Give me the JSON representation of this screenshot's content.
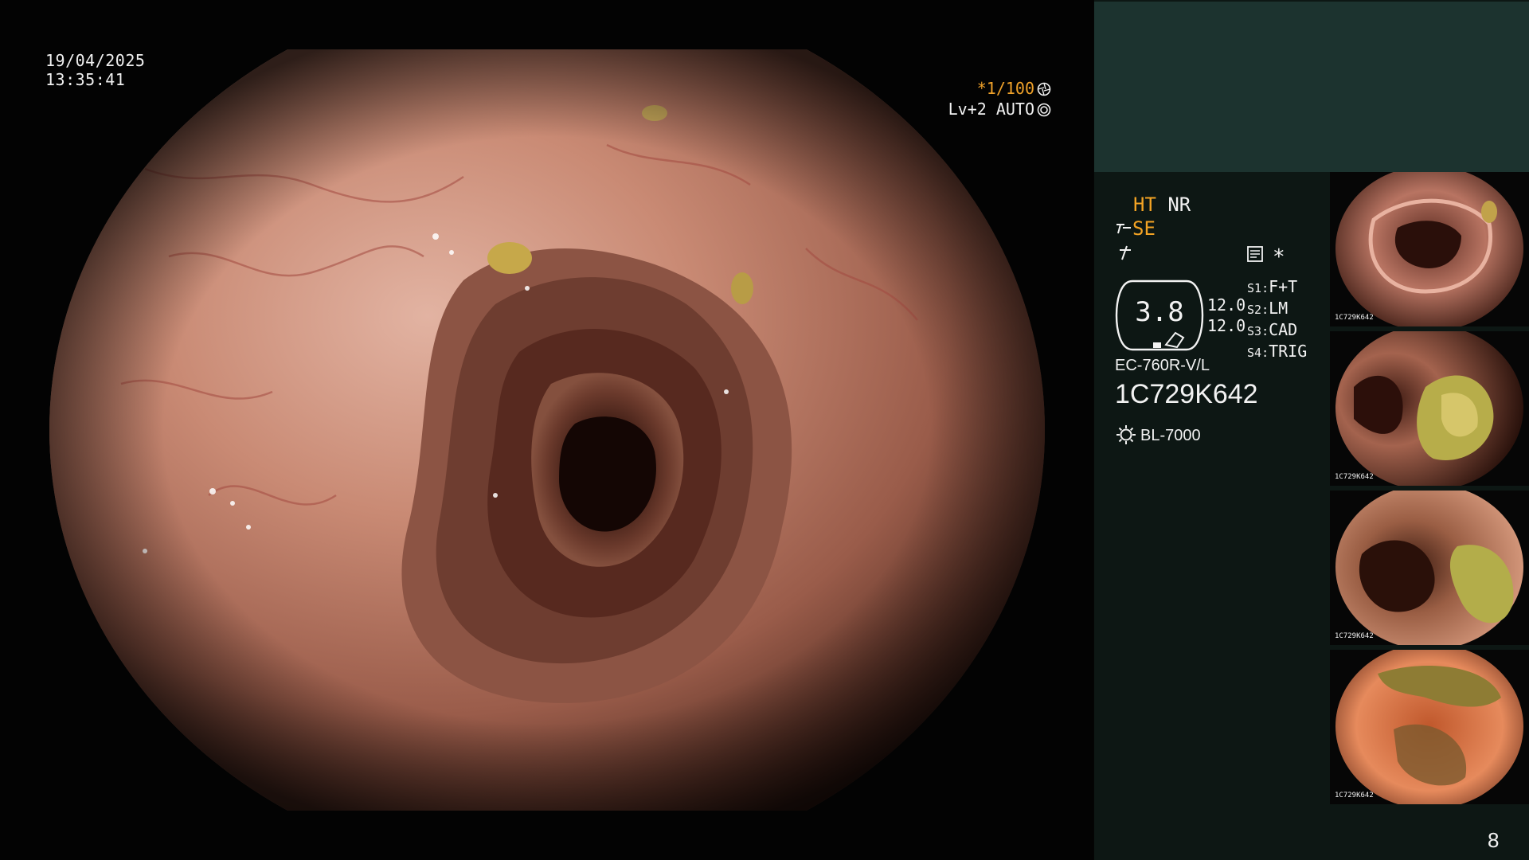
{
  "datetime": {
    "date": "19/04/2025",
    "time": "13:35:41"
  },
  "overlay": {
    "shutter": "*1/100",
    "shutter_icon": "aperture-icon",
    "level": "Lv+2 AUTO",
    "level_icon": "iris-icon"
  },
  "info": {
    "ht": "HT",
    "nr": "NR",
    "se": "SE",
    "zoom_value": "3.8",
    "val1": "12.0",
    "val2": "12.0",
    "switches": [
      {
        "key": "S1",
        "value": "F+T"
      },
      {
        "key": "S2",
        "value": "LM"
      },
      {
        "key": "S3",
        "value": "CAD"
      },
      {
        "key": "S4",
        "value": "TRIG"
      }
    ],
    "star": "*",
    "scope_model": "EC-760R-V/L",
    "serial": "1C729K642",
    "light_source": "BL-7000"
  },
  "thumbnails": [
    {
      "id": "thumb-1",
      "serial": "1C729K642"
    },
    {
      "id": "thumb-2",
      "serial": "1C729K642"
    },
    {
      "id": "thumb-3",
      "serial": "1C729K642"
    },
    {
      "id": "thumb-4",
      "serial": "1C729K642"
    }
  ],
  "page_number": "8",
  "colors": {
    "panel_background": "#0d1714",
    "teal_box": "#1c332f",
    "accent_orange": "#f3a324",
    "mucosa": "#c98872"
  }
}
